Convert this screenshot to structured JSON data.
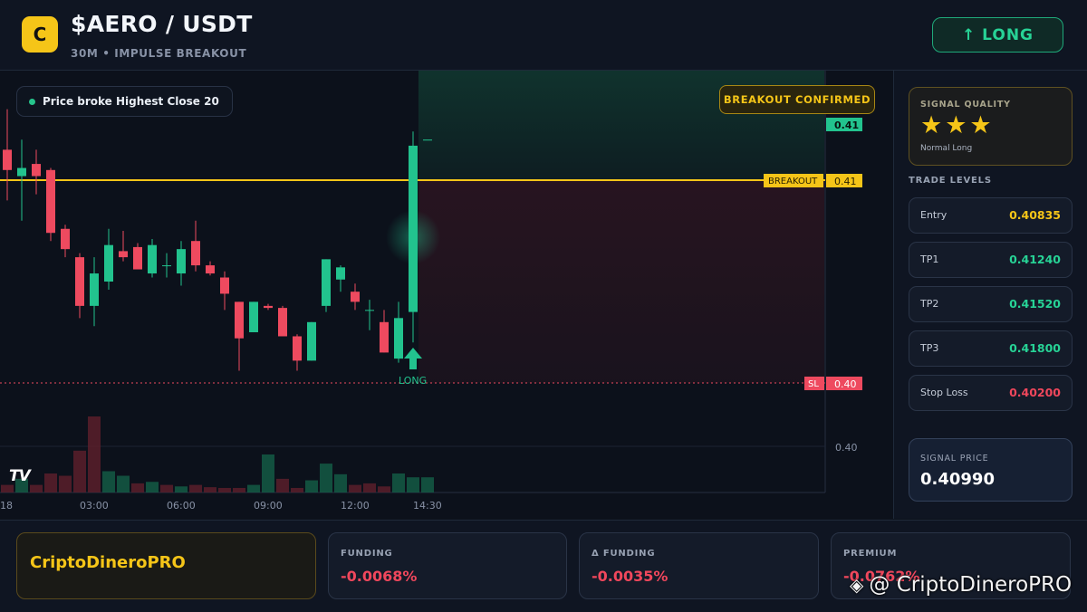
{
  "header": {
    "logo_letter": "C",
    "pair": "$AERO / USDT",
    "subtitle": "30M • IMPULSE BREAKOUT",
    "long_button": "↑ LONG"
  },
  "chart": {
    "info_pill": "Price broke Highest Close 20",
    "badge": "BREAKOUT CONFIRMED",
    "breakout_label": "BREAKOUT",
    "breakout_price": "0.41",
    "top_price": "0.41",
    "sl_label": "SL",
    "sl_price": "0.40",
    "axis_price": "0.40",
    "long_marker": "LONG",
    "tv_logo": "TV",
    "time_labels": [
      "18",
      "03:00",
      "06:00",
      "09:00",
      "12:00",
      "14:30"
    ],
    "colors": {
      "up": "#22c38e",
      "down": "#ee4a5f",
      "breakout": "#f5c518"
    }
  },
  "chart_data": {
    "type": "candlestick",
    "x_ticks": [
      "18",
      "03:00",
      "06:00",
      "09:00",
      "12:00",
      "14:30"
    ],
    "levels": {
      "breakout": 0.41,
      "stop_loss": 0.4
    },
    "candles_ohlc": [
      [
        0.4115,
        0.4135,
        0.409,
        0.4105
      ],
      [
        0.4102,
        0.412,
        0.408,
        0.4106
      ],
      [
        0.4108,
        0.4115,
        0.4093,
        0.4102
      ],
      [
        0.4105,
        0.4106,
        0.407,
        0.4074
      ],
      [
        0.4076,
        0.4078,
        0.4062,
        0.4066
      ],
      [
        0.4062,
        0.4064,
        0.4032,
        0.4038
      ],
      [
        0.4038,
        0.4062,
        0.4028,
        0.4054
      ],
      [
        0.405,
        0.4076,
        0.4046,
        0.4068
      ],
      [
        0.4065,
        0.4075,
        0.406,
        0.4062
      ],
      [
        0.4067,
        0.4069,
        0.4056,
        0.4056
      ],
      [
        0.4054,
        0.4071,
        0.4052,
        0.4068
      ],
      [
        0.4058,
        0.4064,
        0.4052,
        0.4058
      ],
      [
        0.4054,
        0.407,
        0.4048,
        0.4066
      ],
      [
        0.407,
        0.408,
        0.4055,
        0.4058
      ],
      [
        0.4058,
        0.406,
        0.4053,
        0.4054
      ],
      [
        0.4052,
        0.4055,
        0.4036,
        0.4044
      ],
      [
        0.404,
        0.404,
        0.4006,
        0.4022
      ],
      [
        0.4025,
        0.404,
        0.4028,
        0.404
      ],
      [
        0.4038,
        0.4039,
        0.4036,
        0.4037
      ],
      [
        0.4037,
        0.4038,
        0.4023,
        0.4023
      ],
      [
        0.4023,
        0.4024,
        0.4006,
        0.4011
      ],
      [
        0.4011,
        0.403,
        0.4011,
        0.403
      ],
      [
        0.4038,
        0.4061,
        0.4035,
        0.4061
      ],
      [
        0.4051,
        0.4058,
        0.4045,
        0.4057
      ],
      [
        0.4045,
        0.4049,
        0.4036,
        0.404
      ],
      [
        0.4036,
        0.4041,
        0.4026,
        0.4036
      ],
      [
        0.403,
        0.4036,
        0.4015,
        0.4015
      ],
      [
        0.4012,
        0.404,
        0.401,
        0.4032
      ],
      [
        0.4035,
        0.4124,
        0.402,
        0.4117
      ],
      [
        0.412,
        0.412,
        0.412,
        0.412
      ]
    ],
    "volume_dir": [
      "down",
      "up",
      "down",
      "down",
      "down",
      "down",
      "down",
      "up",
      "up",
      "down",
      "up",
      "down",
      "up",
      "down",
      "down",
      "down",
      "down",
      "up",
      "up",
      "down",
      "down",
      "up",
      "up",
      "up",
      "down",
      "down",
      "down",
      "up",
      "up",
      "up"
    ],
    "volume_rel": [
      0.1,
      0.18,
      0.1,
      0.25,
      0.22,
      0.55,
      1.0,
      0.28,
      0.22,
      0.12,
      0.14,
      0.1,
      0.08,
      0.1,
      0.07,
      0.06,
      0.06,
      0.1,
      0.5,
      0.18,
      0.06,
      0.16,
      0.38,
      0.24,
      0.1,
      0.12,
      0.08,
      0.25,
      0.2,
      0.2
    ]
  },
  "panel": {
    "quality_title": "SIGNAL QUALITY",
    "stars": "★★★",
    "quality_label": "Normal Long",
    "levels_title": "TRADE LEVELS",
    "levels": [
      {
        "name": "Entry",
        "value": "0.40835",
        "color": "#f5c518"
      },
      {
        "name": "TP1",
        "value": "0.41240",
        "color": "#27d396"
      },
      {
        "name": "TP2",
        "value": "0.41520",
        "color": "#27d396"
      },
      {
        "name": "TP3",
        "value": "0.41800",
        "color": "#27d396"
      },
      {
        "name": "Stop Loss",
        "value": "0.40200",
        "color": "#f0475c"
      }
    ],
    "signal_price_title": "SIGNAL PRICE",
    "signal_price": "0.40990"
  },
  "footer": {
    "brand": "CriptoDineroPRO",
    "metrics": [
      {
        "title": "FUNDING",
        "value": "-0.0068%"
      },
      {
        "title": "Δ FUNDING",
        "value": "-0.0035%"
      },
      {
        "title": "PREMIUM",
        "value": "-0.0762%"
      }
    ],
    "watermark": "@ CriptoDineroPRO"
  }
}
